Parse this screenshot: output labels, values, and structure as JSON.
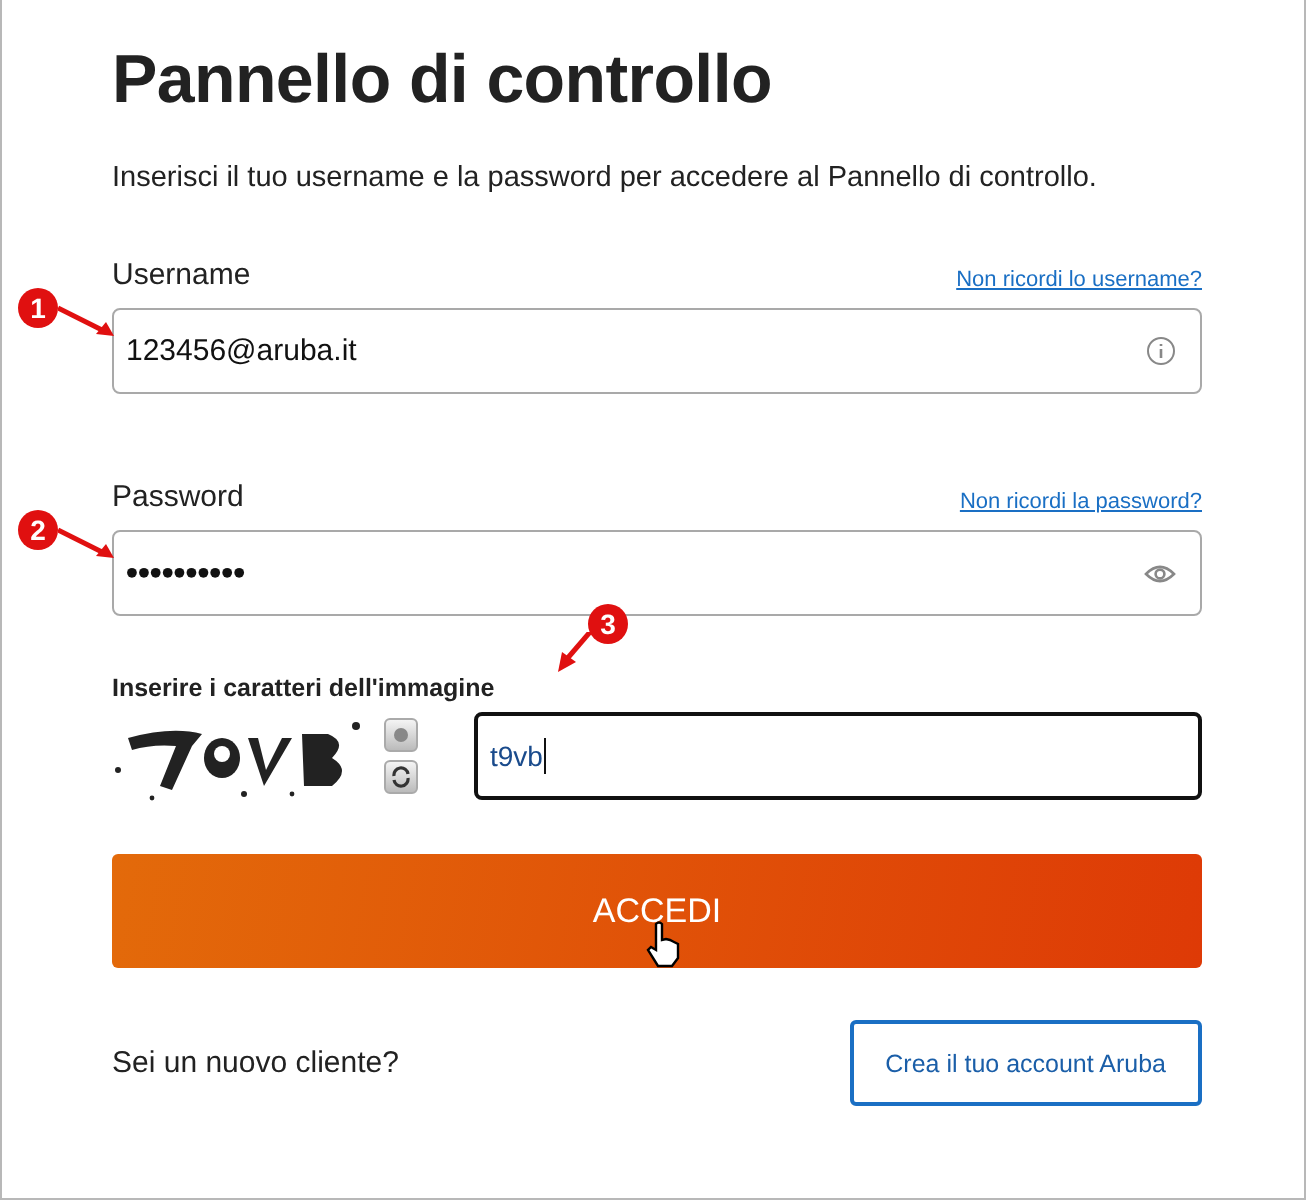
{
  "title": "Pannello di controllo",
  "description": "Inserisci il tuo username e la password per accedere al Pannello di controllo.",
  "fields": [
    {
      "kind": "text",
      "label": "Username",
      "link": "Non ricordi lo username?",
      "value": "123456@aruba.it",
      "callout": "1"
    },
    {
      "kind": "password",
      "label": "Password",
      "link": "Non ricordi la password?",
      "value": "••••••••••",
      "callout": "2"
    }
  ],
  "captcha": {
    "label": "Inserire i caratteri dell'immagine",
    "value": "t9vb",
    "callout": "3"
  },
  "submit": "ACCEDI",
  "signup": {
    "question": "Sei un nuovo cliente?",
    "button": "Crea il tuo account Aruba"
  }
}
